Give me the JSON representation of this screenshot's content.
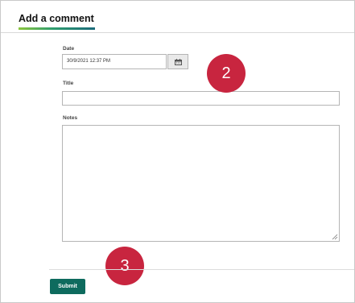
{
  "form": {
    "title": "Add a comment",
    "date_label": "Date",
    "date_value": "30/9/2021 12:37 PM",
    "title_label": "Title",
    "title_value": "",
    "notes_label": "Notes",
    "notes_value": "",
    "submit_label": "Submit"
  },
  "annotations": {
    "step_2": "2",
    "step_3": "3"
  },
  "icons": {
    "calendar": "calendar-icon",
    "resize": "resize-grip-icon"
  },
  "colors": {
    "accent_green": "#8cc63f",
    "accent_teal": "#1b6a7a",
    "submit_bg": "#0e6b5e",
    "badge_red": "#c8253f"
  }
}
